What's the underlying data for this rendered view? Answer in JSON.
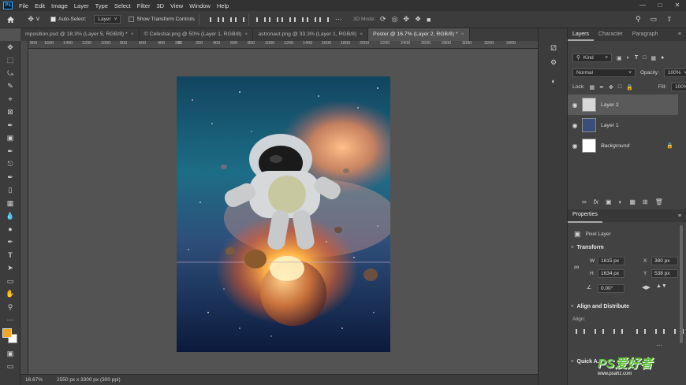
{
  "menubar": {
    "logo": "Ps",
    "items": [
      "File",
      "Edit",
      "Image",
      "Layer",
      "Type",
      "Select",
      "Filter",
      "3D",
      "View",
      "Window",
      "Help"
    ]
  },
  "options": {
    "auto_select_label": "Auto-Select:",
    "layer_select": "Layer",
    "transform_controls_label": "Show Transform Controls",
    "mode_3d_label": "3D Mode:"
  },
  "tabs": [
    {
      "label": "mposition.psd @ 18.3% (Layer 5, RGB/8) *"
    },
    {
      "label": "© Celestial.png @ 50% (Layer 1, RGB/8)"
    },
    {
      "label": "astronaut.png @ 33.3% (Layer 1, RGB/8)"
    },
    {
      "label": "Poster @ 16.7% (Layer 2, RGB/8) *"
    }
  ],
  "ruler": {
    "top_ticks": [
      "800",
      "1600",
      "1400",
      "1200",
      "1000",
      "800",
      "600",
      "400",
      "200",
      "0",
      "200",
      "400",
      "600",
      "800",
      "1000",
      "1200",
      "1400",
      "1600",
      "1800",
      "2000",
      "2200",
      "2400",
      "2600",
      "2800",
      "3000",
      "3200",
      "3400"
    ]
  },
  "status": {
    "zoom": "16.67%",
    "doc_size": "2550 px x 3300 px (300 ppi)"
  },
  "layers_panel": {
    "tabs": [
      "Layers",
      "Character",
      "Paragraph"
    ],
    "kind": "Kind",
    "blend_mode": "Normal",
    "opacity_label": "Opacity:",
    "opacity_value": "100%",
    "lock_label": "Lock:",
    "fill_label": "Fill:",
    "fill_value": "100%",
    "layers": [
      {
        "name": "Layer 2"
      },
      {
        "name": "Layer 1"
      },
      {
        "name": "Background"
      }
    ]
  },
  "properties_panel": {
    "title": "Properties",
    "layer_type": "Pixel Layer",
    "transform_title": "Transform",
    "w_label": "W",
    "w_value": "1615 px",
    "h_label": "H",
    "h_value": "1634 px",
    "x_label": "X",
    "x_value": "380 px",
    "y_label": "Y",
    "y_value": "538 px",
    "angle_value": "0.00°",
    "align_title": "Align and Distribute",
    "align_label": "Align:",
    "quick_actions_title": "Quick A..."
  },
  "watermark": {
    "text": "PS爱好者",
    "url": "www.psahz.com"
  },
  "colors": {
    "accent": "#31a8ff",
    "foreground_swatch": "#f5a623",
    "background_swatch": "#ffffff"
  }
}
